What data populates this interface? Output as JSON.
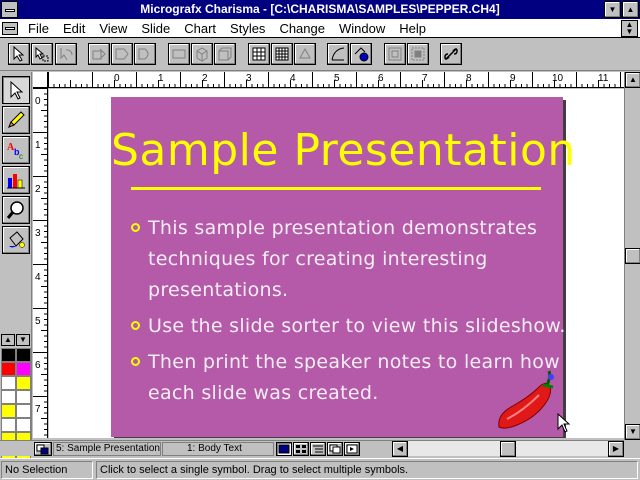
{
  "window": {
    "title": "Micrografx Charisma - [C:\\CHARISMA\\SAMPLES\\PEPPER.CH4]"
  },
  "menu": {
    "items": [
      "File",
      "Edit",
      "View",
      "Slide",
      "Chart",
      "Styles",
      "Change",
      "Window",
      "Help"
    ]
  },
  "toolbar": {
    "buttons": [
      "select-tool",
      "lasso-select",
      "rotate-select",
      "arrange-forward",
      "arrange-backward",
      "draw-rectangle",
      "3d-box",
      "3d-shape",
      "grid-table",
      "align-grid",
      "color-style",
      "fill-object",
      "group-objects",
      "ungroup-objects",
      "link-objects"
    ]
  },
  "tools": {
    "items": [
      "pointer",
      "pencil",
      "text",
      "chart",
      "zoom",
      "fill"
    ]
  },
  "palette": {
    "colors": [
      "#000000",
      "#000000",
      "#ff0000",
      "#ff00ff",
      "#ffffff",
      "#ffff00",
      "#ffffff",
      "#ffffff",
      "#ffff00",
      "#ffffff",
      "#ffffff",
      "#ffffff",
      "#ffff00",
      "#ffff00",
      "#ffff00",
      "#ffff00",
      "#ff8080",
      "#00c000",
      "#ff8040",
      "#00ff80",
      "#c0c0c0",
      "#808080"
    ]
  },
  "rulers": {
    "horizontal": [
      "0",
      "1",
      "2",
      "3",
      "4",
      "5",
      "6",
      "7",
      "8",
      "9",
      "10",
      "11"
    ],
    "vertical": [
      "0",
      "1",
      "2",
      "3",
      "4",
      "5",
      "6",
      "7"
    ]
  },
  "slide": {
    "title": "Sample Presentation",
    "bullets": [
      {
        "lines": [
          "This sample presentation demonstrates",
          "techniques for creating interesting",
          "presentations."
        ]
      },
      {
        "lines": [
          "Use the slide sorter to view this slideshow."
        ]
      },
      {
        "lines": [
          "Then print the speaker notes to learn how",
          "each slide was created."
        ]
      }
    ],
    "colors": {
      "background": "#b45aa8",
      "title": "#ffff00",
      "text": "#f4eef4",
      "bullet": "#ffff00"
    }
  },
  "bottom": {
    "slide_field": "5: Sample Presentation",
    "layer_field": "1: Body Text"
  },
  "status": {
    "selection": "No Selection",
    "hint": "Click to select a single symbol. Drag to select multiple symbols."
  }
}
